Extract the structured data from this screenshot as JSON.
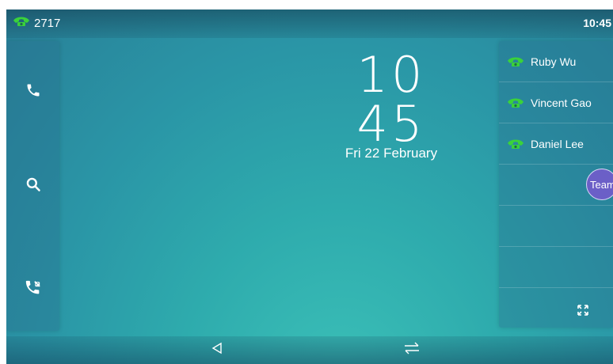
{
  "status": {
    "extension": "2717",
    "time": "10:45"
  },
  "clock": {
    "time": "10 45",
    "date": "Fri 22 February"
  },
  "left_buttons": [
    {
      "icon": "phone-icon"
    },
    {
      "icon": "search-icon"
    },
    {
      "icon": "call-log-icon"
    }
  ],
  "dsskeys": [
    {
      "label": "Ruby Wu",
      "icon": "green-phone-icon"
    },
    {
      "label": "Vincent Gao",
      "icon": "green-phone-icon"
    },
    {
      "label": "Daniel Lee",
      "icon": "green-phone-icon"
    },
    {
      "label": "",
      "badge": "Team"
    },
    {
      "label": ""
    },
    {
      "label": ""
    }
  ],
  "colors": {
    "line_green": "#3ad23a",
    "team_badge": "#6b5fc7"
  }
}
